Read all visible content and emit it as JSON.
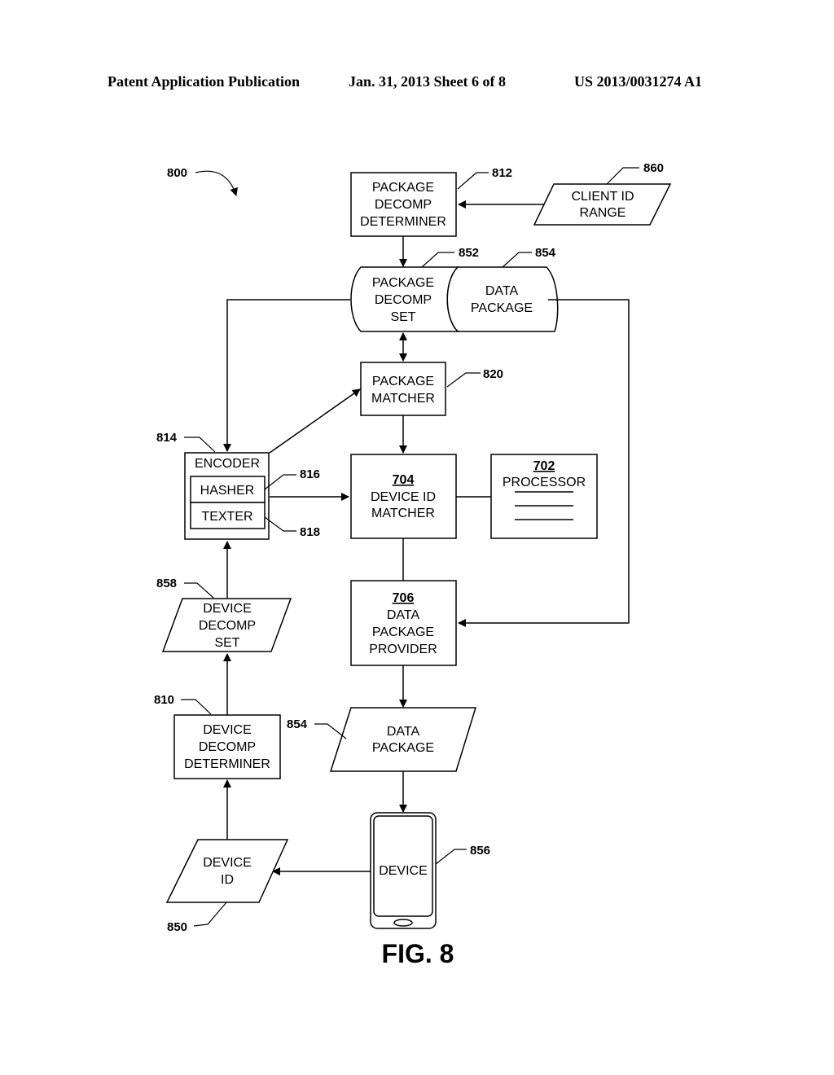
{
  "header": {
    "publication": "Patent Application Publication",
    "date_sheet": "Jan. 31, 2013   Sheet 6 of 8",
    "number": "US 2013/0031274 A1"
  },
  "figure": {
    "title": "FIG. 8",
    "ref": "800",
    "nodes": {
      "package_decomp_determiner": {
        "ref": "812",
        "lines": [
          "PACKAGE",
          "DECOMP",
          "DETERMINER"
        ]
      },
      "client_id_range": {
        "ref": "860",
        "lines": [
          "CLIENT ID",
          "RANGE"
        ]
      },
      "package_decomp_set": {
        "ref": "852",
        "lines": [
          "PACKAGE",
          "DECOMP",
          "SET"
        ]
      },
      "data_package_top": {
        "ref": "854",
        "lines": [
          "DATA",
          "PACKAGE"
        ]
      },
      "package_matcher": {
        "ref": "820",
        "lines": [
          "PACKAGE",
          "MATCHER"
        ]
      },
      "encoder": {
        "ref": "814",
        "label": "ENCODER"
      },
      "hasher": {
        "ref": "816",
        "label": "HASHER"
      },
      "texter": {
        "ref": "818",
        "label": "TEXTER"
      },
      "device_id_matcher": {
        "num": "704",
        "lines": [
          "DEVICE ID",
          "MATCHER"
        ]
      },
      "processor": {
        "num": "702",
        "label": "PROCESSOR"
      },
      "device_decomp_set": {
        "ref": "858",
        "lines": [
          "DEVICE",
          "DECOMP",
          "SET"
        ]
      },
      "data_package_provider": {
        "num": "706",
        "lines": [
          "DATA",
          "PACKAGE",
          "PROVIDER"
        ]
      },
      "device_decomp_determiner": {
        "ref": "810",
        "lines": [
          "DEVICE",
          "DECOMP",
          "DETERMINER"
        ]
      },
      "data_package_bottom": {
        "ref": "854",
        "lines": [
          "DATA",
          "PACKAGE"
        ]
      },
      "device_id": {
        "ref": "850",
        "lines": [
          "DEVICE",
          "ID"
        ]
      },
      "device": {
        "ref": "856",
        "label": "DEVICE"
      }
    }
  }
}
